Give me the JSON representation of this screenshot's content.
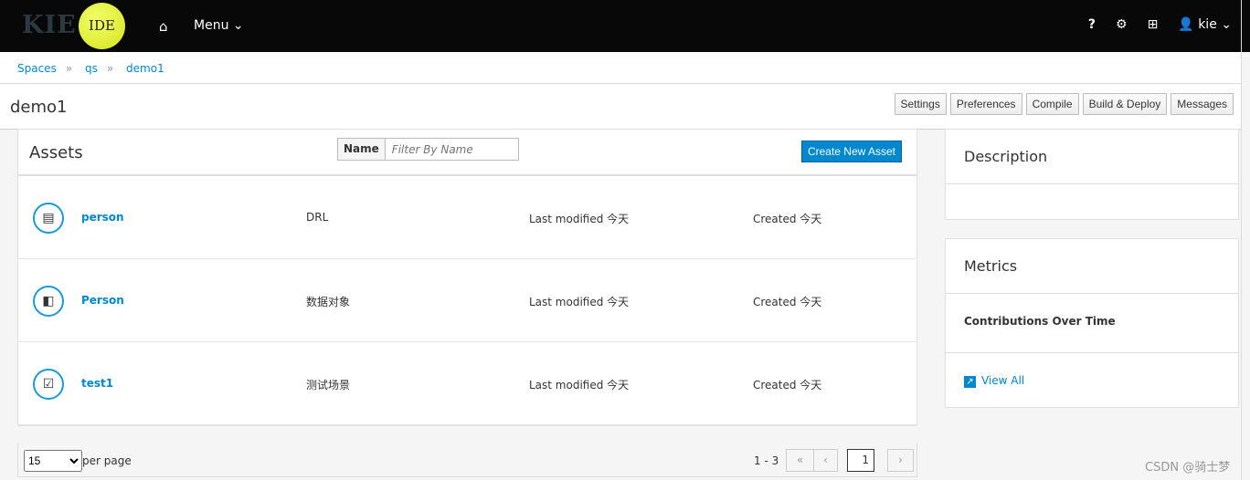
{
  "header": {
    "logo_text": "KIE",
    "logo_badge": "IDE",
    "menu_label": "Menu ⌄",
    "user": "kie ⌄",
    "icons": [
      "home-icon",
      "help-icon",
      "gear-icon",
      "briefcase-icon",
      "user-icon"
    ]
  },
  "breadcrumb": [
    "Spaces",
    "qs",
    "demo1"
  ],
  "page": {
    "title": "demo1",
    "buttons": [
      "Settings",
      "Preferences",
      "Compile",
      "Build & Deploy",
      "Messages"
    ]
  },
  "assets": {
    "title": "Assets",
    "filter_label": "Name",
    "filter_placeholder": "Filter By Name",
    "create_label": "Create New Asset",
    "rows": [
      {
        "name": "person",
        "type": "DRL",
        "modified": "Last modified 今天",
        "created": "Created 今天",
        "icon": "drl-file-icon"
      },
      {
        "name": "Person",
        "type": "数据对象",
        "modified": "Last modified 今天",
        "created": "Created 今天",
        "icon": "data-object-icon"
      },
      {
        "name": "test1",
        "type": "测试场景",
        "modified": "Last modified 今天",
        "created": "Created 今天",
        "icon": "test-scenario-icon"
      }
    ]
  },
  "pagination": {
    "per_page_value": "15",
    "per_page_label": "per page",
    "range": "1 - 3",
    "current_page": "1"
  },
  "description": {
    "title": "Description"
  },
  "metrics": {
    "title": "Metrics",
    "subtitle": "Contributions Over Time",
    "view_all": "View All"
  },
  "watermark": "CSDN @骑士梦"
}
